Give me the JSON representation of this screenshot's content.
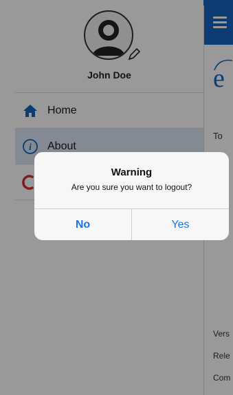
{
  "profile": {
    "name": "John Doe",
    "avatar_icon": "person-silhouette-icon",
    "edit_icon": "pencil-icon"
  },
  "menu": {
    "items": [
      {
        "label": "Home",
        "icon": "home-icon",
        "active": false
      },
      {
        "label": "About",
        "icon": "info-icon",
        "active": true
      },
      {
        "label": "",
        "icon": "logout-icon",
        "active": false
      }
    ]
  },
  "content": {
    "logo_char": "e",
    "text_to": "To",
    "text_vers": "Vers",
    "text_rele": "Rele",
    "text_com": "Com"
  },
  "dialog": {
    "title": "Warning",
    "message": "Are you sure you want to logout?",
    "no_label": "No",
    "yes_label": "Yes"
  },
  "colors": {
    "accent": "#1565c0",
    "button_text": "#1a73e8",
    "active_row": "#dbe7f6",
    "logout_icon": "#d32f2f"
  }
}
